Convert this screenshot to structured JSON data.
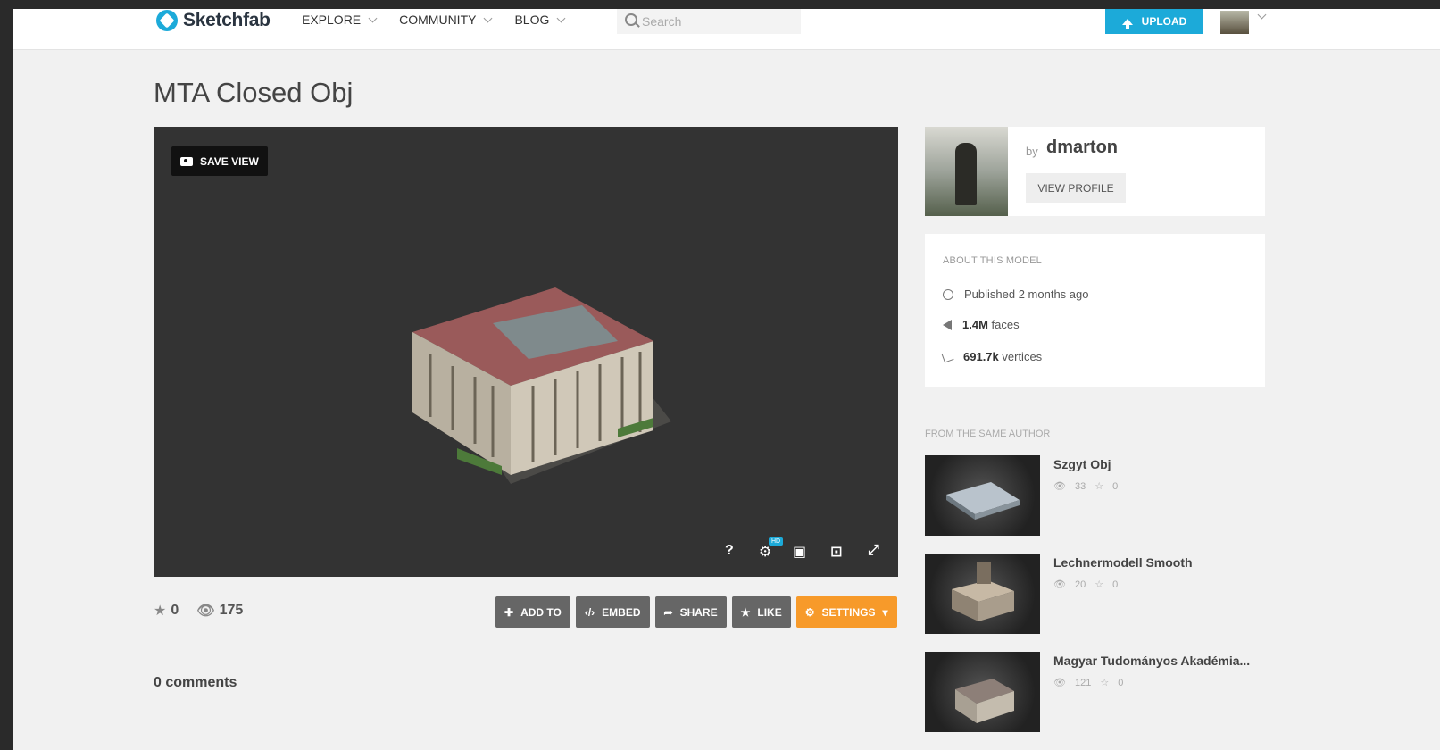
{
  "nav": {
    "logo_text": "Sketchfab",
    "items": [
      {
        "label": "EXPLORE"
      },
      {
        "label": "COMMUNITY"
      },
      {
        "label": "BLOG"
      }
    ],
    "search_placeholder": "Search",
    "upload_label": "UPLOAD"
  },
  "model": {
    "title": "MTA Closed Obj",
    "save_view_label": "SAVE VIEW",
    "hd_badge": "HD",
    "help_label": "?",
    "likes": "0",
    "views": "175",
    "comments_label": "0 comments"
  },
  "actions": {
    "add_to": "ADD TO",
    "embed": "EMBED",
    "share": "SHARE",
    "like": "LIKE",
    "settings": "SETTINGS"
  },
  "author": {
    "by": "by",
    "name": "dmarton",
    "view_profile": "VIEW PROFILE"
  },
  "about": {
    "heading": "ABOUT THIS MODEL",
    "published": "Published 2 months ago",
    "faces_value": "1.4M",
    "faces_label": "faces",
    "vertices_value": "691.7k",
    "vertices_label": "vertices"
  },
  "related": {
    "heading": "FROM THE SAME AUTHOR",
    "items": [
      {
        "title": "Szgyt Obj",
        "views": "33",
        "likes": "0"
      },
      {
        "title": "Lechnermodell Smooth",
        "views": "20",
        "likes": "0"
      },
      {
        "title": "Magyar Tudományos Akadémia...",
        "views": "121",
        "likes": "0"
      }
    ]
  },
  "colors": {
    "accent": "#1caad9",
    "settings": "#f79a2a",
    "viewer_bg": "#333333"
  }
}
